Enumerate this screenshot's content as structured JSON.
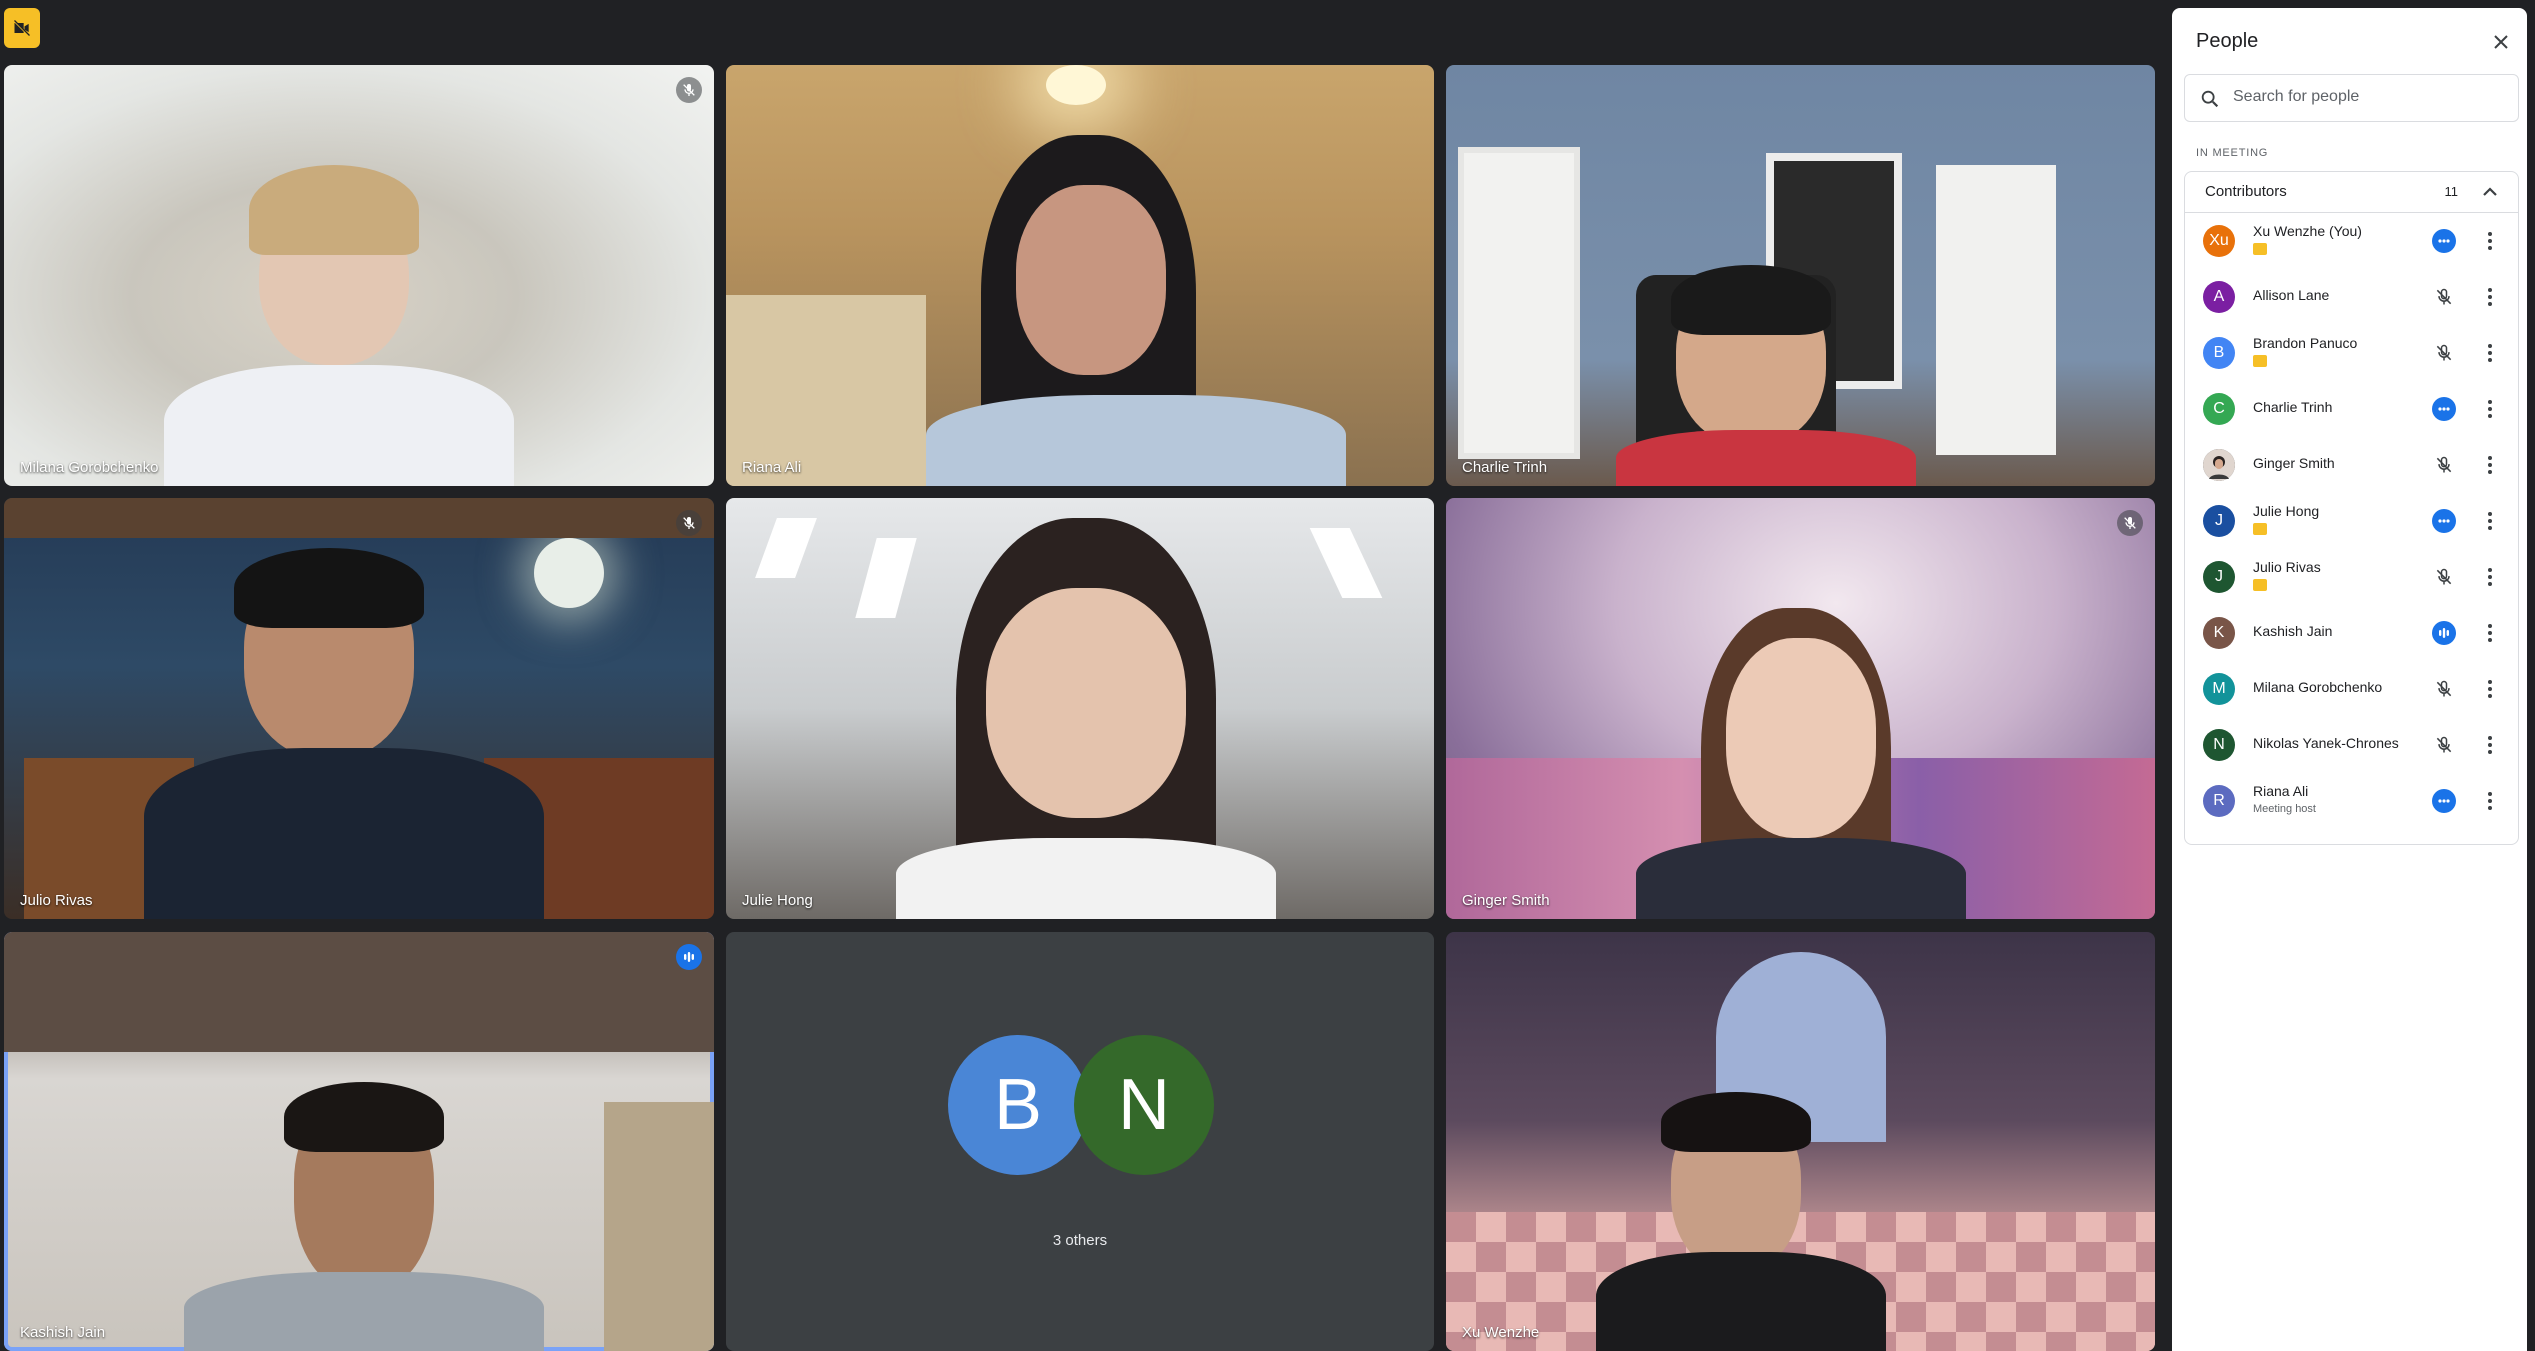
{
  "top_button": {
    "icon": "video-off-icon",
    "color": "#f6bf26"
  },
  "tiles": {
    "t1": {
      "name": "Milana Gorobchenko",
      "status": "muted"
    },
    "t2": {
      "name": "Riana Ali",
      "status": "none"
    },
    "t3": {
      "name": "Charlie Trinh",
      "status": "none"
    },
    "t4": {
      "name": "Julio Rivas",
      "status": "muted"
    },
    "t5": {
      "name": "Julie Hong",
      "status": "none"
    },
    "t6": {
      "name": "Ginger Smith",
      "status": "muted"
    },
    "t7": {
      "name": "Kashish Jain",
      "status": "speaking"
    },
    "t8": {
      "avatar1": "B",
      "avatar2": "N",
      "label": "3 others",
      "avatar1_color": "#4285f4",
      "avatar2_color": "#34691e"
    },
    "t9": {
      "name": "Xu Wenzhe",
      "status": "none"
    }
  },
  "panel": {
    "title": "People",
    "search_placeholder": "Search for people",
    "section_label": "IN MEETING",
    "group_label": "Contributors",
    "group_count": "11",
    "people": [
      {
        "initial": "Xu",
        "name": "Xu Wenzhe (You)",
        "color": "#e8710a",
        "status": "more-blue",
        "badge": true,
        "sub": ""
      },
      {
        "initial": "A",
        "name": "Allison Lane",
        "color": "#7b1fa2",
        "status": "muted",
        "badge": false,
        "sub": ""
      },
      {
        "initial": "B",
        "name": "Brandon Panuco",
        "color": "#4285f4",
        "status": "muted",
        "badge": true,
        "sub": ""
      },
      {
        "initial": "C",
        "name": "Charlie Trinh",
        "color": "#34a853",
        "status": "more-blue",
        "badge": false,
        "sub": ""
      },
      {
        "initial": "",
        "name": "Ginger Smith",
        "color": "#3c4043",
        "status": "muted",
        "badge": false,
        "sub": ""
      },
      {
        "initial": "J",
        "name": "Julie Hong",
        "color": "#1a4fa0",
        "status": "more-blue",
        "badge": true,
        "sub": ""
      },
      {
        "initial": "J",
        "name": "Julio Rivas",
        "color": "#1e5631",
        "status": "muted",
        "badge": true,
        "sub": ""
      },
      {
        "initial": "K",
        "name": "Kashish Jain",
        "color": "#795548",
        "status": "speaking",
        "badge": false,
        "sub": ""
      },
      {
        "initial": "M",
        "name": "Milana Gorobchenko",
        "color": "#12939a",
        "status": "muted",
        "badge": false,
        "sub": ""
      },
      {
        "initial": "N",
        "name": "Nikolas Yanek-Chrones",
        "color": "#1e5631",
        "status": "muted",
        "badge": false,
        "sub": ""
      },
      {
        "initial": "R",
        "name": "Riana Ali",
        "color": "#5c6bc0",
        "status": "more-blue",
        "badge": false,
        "sub": "Meeting host"
      }
    ]
  }
}
